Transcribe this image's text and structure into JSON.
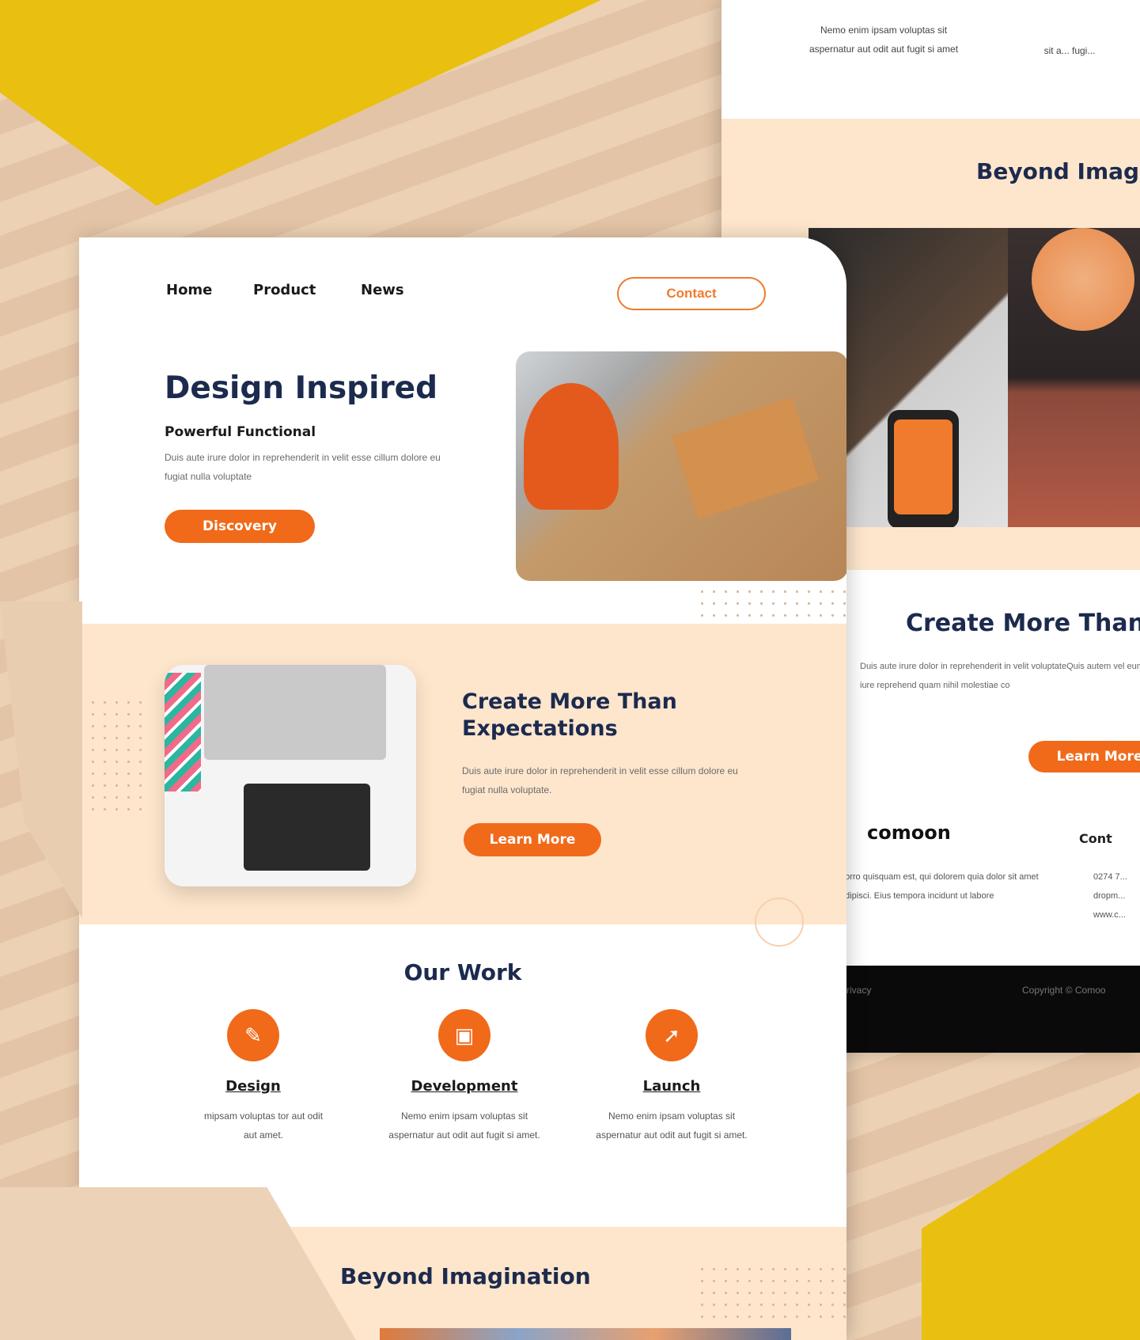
{
  "colors": {
    "accent": "#f06a1a",
    "navy": "#1c2a4e",
    "peach": "#fde6cc",
    "yellow": "#e9c010"
  },
  "back_page": {
    "top_text": "Nemo enim ipsam voluptas sit aspernatur aut odit aut fugit si amet",
    "top_text_partial": "sit a... fugi...",
    "heading": "Beyond Imag",
    "section_title": "Create More Than I",
    "section_text": "Duis aute irure dolor in reprehenderit in velit voluptateQuis autem vel eum iure reprehend quam nihil molestiae co",
    "button": "Learn More",
    "logo": "comoon",
    "footer_about": "porro quisquam est, qui dolorem quia dolor sit amet adipisci. Eius tempora incidunt ut labore",
    "contact_heading": "Cont",
    "contact_lines": [
      "0274 7...",
      "dropm...",
      "www.c..."
    ],
    "privacy": "Privacy",
    "copyright": "Copyright © Comoo"
  },
  "nav": {
    "home": "Home",
    "product": "Product",
    "news": "News",
    "contact": "Contact"
  },
  "hero": {
    "title": "Design Inspired",
    "subtitle": "Powerful Functional",
    "text": "Duis aute irure dolor in reprehenderit in velit esse cillum dolore eu fugiat nulla voluptate",
    "button": "Discovery"
  },
  "expect": {
    "title": "Create More Than Expectations",
    "text": "Duis aute irure dolor in reprehenderit in velit esse cillum dolore eu fugiat nulla voluptate.",
    "button": "Learn More"
  },
  "work": {
    "title": "Our Work",
    "items": [
      {
        "icon": "pen-icon",
        "title": "Design",
        "text": "mipsam voluptas tor aut odit aut amet."
      },
      {
        "icon": "monitor-icon",
        "title": "Development",
        "text": "Nemo enim ipsam voluptas sit aspernatur aut odit aut fugit si amet."
      },
      {
        "icon": "rocket-icon",
        "title": "Launch",
        "text": "Nemo enim ipsam voluptas sit aspernatur aut odit aut fugit si amet."
      }
    ]
  },
  "beyond": {
    "title": "Beyond Imagination"
  }
}
